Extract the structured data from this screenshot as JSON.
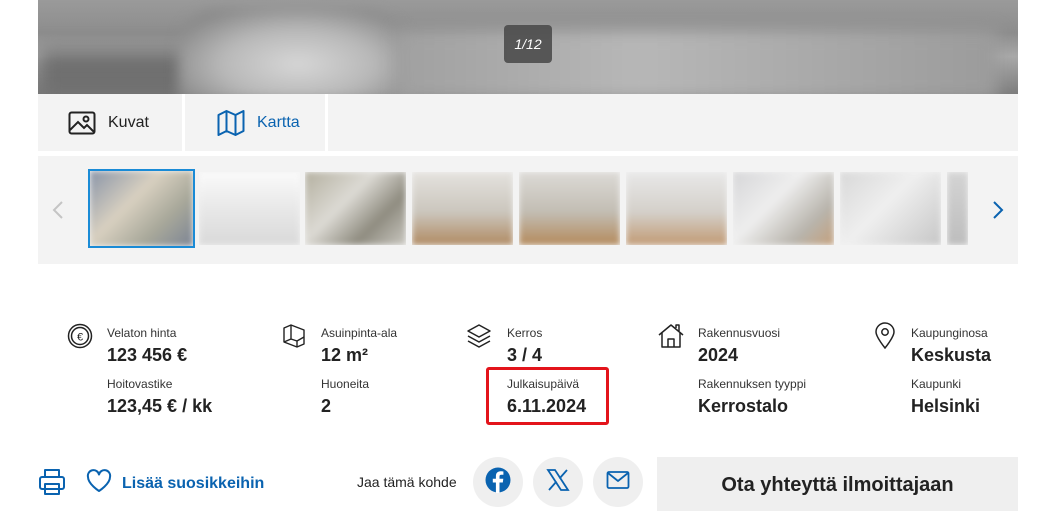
{
  "gallery": {
    "counter": "1/12",
    "tabs": {
      "images_label": "Kuvat",
      "map_label": "Kartta"
    },
    "thumbnail_count": 9,
    "accent_color": "#0a63b0"
  },
  "facts": {
    "price_label": "Velaton hinta",
    "price_value": "123 456 €",
    "fee_label": "Hoitovastike",
    "fee_value": "123,45 € / kk",
    "area_label": "Asuinpinta-ala",
    "area_value": "12 m²",
    "rooms_label": "Huoneita",
    "rooms_value": "2",
    "floor_label": "Kerros",
    "floor_value": "3 / 4",
    "published_label": "Julkaisupäivä",
    "published_value": "6.11.2024",
    "year_label": "Rakennusvuosi",
    "year_value": "2024",
    "building_type_label": "Rakennuksen tyyppi",
    "building_type_value": "Kerrostalo",
    "district_label": "Kaupunginosa",
    "district_value": "Keskusta",
    "city_label": "Kaupunki",
    "city_value": "Helsinki",
    "highlight_color": "#e3141b"
  },
  "actions": {
    "favorite_label": "Lisää suosikkeihin",
    "share_label": "Jaa tämä kohde",
    "contact_label": "Ota yhteyttä ilmoittajaan"
  }
}
